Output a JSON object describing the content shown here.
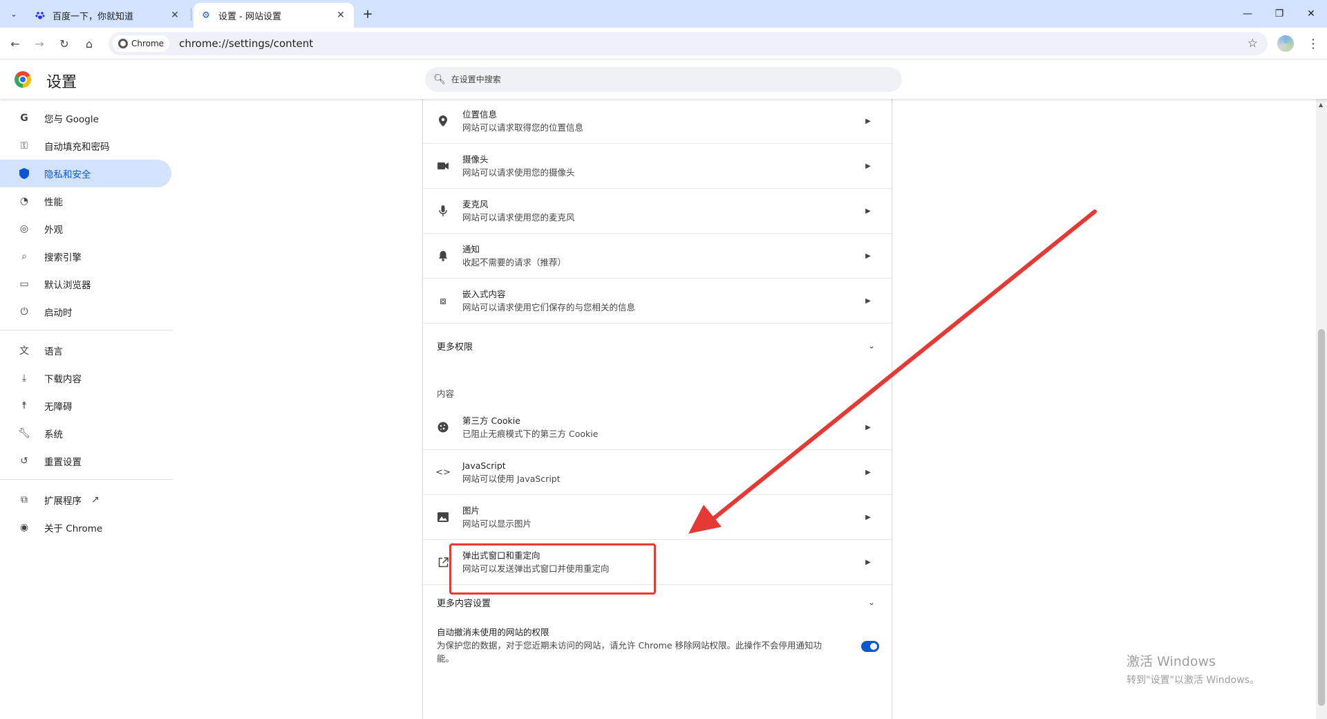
{
  "tabs": [
    {
      "title": "百度一下，你就知道",
      "favicon": "baidu-paw-icon"
    },
    {
      "title": "设置 - 网站设置",
      "favicon": "gear-icon"
    }
  ],
  "toolbar": {
    "chip_label": "Chrome",
    "url": "chrome://settings/content"
  },
  "header": {
    "title": "设置",
    "search_placeholder": "在设置中搜索"
  },
  "sidebar": {
    "items": [
      {
        "label": "您与 Google",
        "icon": "google-g-icon"
      },
      {
        "label": "自动填充和密码",
        "icon": "key-icon"
      },
      {
        "label": "隐私和安全",
        "icon": "shield-icon"
      },
      {
        "label": "性能",
        "icon": "speedometer-icon"
      },
      {
        "label": "外观",
        "icon": "palette-icon"
      },
      {
        "label": "搜索引擎",
        "icon": "search-icon"
      },
      {
        "label": "默认浏览器",
        "icon": "browser-window-icon"
      },
      {
        "label": "启动时",
        "icon": "power-icon"
      },
      {
        "label": "语言",
        "icon": "translate-icon"
      },
      {
        "label": "下载内容",
        "icon": "download-icon"
      },
      {
        "label": "无障碍",
        "icon": "accessibility-icon"
      },
      {
        "label": "系统",
        "icon": "wrench-icon"
      },
      {
        "label": "重置设置",
        "icon": "reset-icon"
      },
      {
        "label": "扩展程序",
        "icon": "puzzle-icon"
      },
      {
        "label": "关于 Chrome",
        "icon": "chrome-logo-icon"
      }
    ],
    "selected": "隐私和安全"
  },
  "permissions": [
    {
      "title": "位置信息",
      "sub": "网站可以请求取得您的位置信息",
      "icon": "location-pin-icon"
    },
    {
      "title": "摄像头",
      "sub": "网站可以请求使用您的摄像头",
      "icon": "camera-icon"
    },
    {
      "title": "麦克风",
      "sub": "网站可以请求使用您的麦克风",
      "icon": "microphone-icon"
    },
    {
      "title": "通知",
      "sub": "收起不需要的请求（推荐）",
      "icon": "bell-icon"
    },
    {
      "title": "嵌入式内容",
      "sub": "网站可以请求使用它们保存的与您相关的信息",
      "icon": "embedded-content-icon"
    }
  ],
  "more_permissions": "更多权限",
  "content_section_label": "内容",
  "content": [
    {
      "title": "第三方 Cookie",
      "sub": "已阻止无痕模式下的第三方 Cookie",
      "icon": "cookie-icon"
    },
    {
      "title": "JavaScript",
      "sub": "网站可以使用 JavaScript",
      "icon": "code-brackets-icon"
    },
    {
      "title": "图片",
      "sub": "网站可以显示图片",
      "icon": "image-icon"
    },
    {
      "title": "弹出式窗口和重定向",
      "sub": "网站可以发送弹出式窗口并使用重定向",
      "icon": "open-external-icon"
    }
  ],
  "more_content_settings": "更多内容设置",
  "auto_revoke": {
    "title": "自动撤消未使用的网站的权限",
    "sub": "为保护您的数据，对于您近期未访问的网站，请允许 Chrome 移除网站权限。此操作不会停用通知功能。",
    "enabled": true
  },
  "watermark": {
    "line1": "激活 Windows",
    "line2": "转到\"设置\"以激活 Windows。"
  },
  "colors": {
    "tabstrip": "#d3e3fd",
    "accent": "#0b57d0",
    "annotation": "#e53935"
  }
}
